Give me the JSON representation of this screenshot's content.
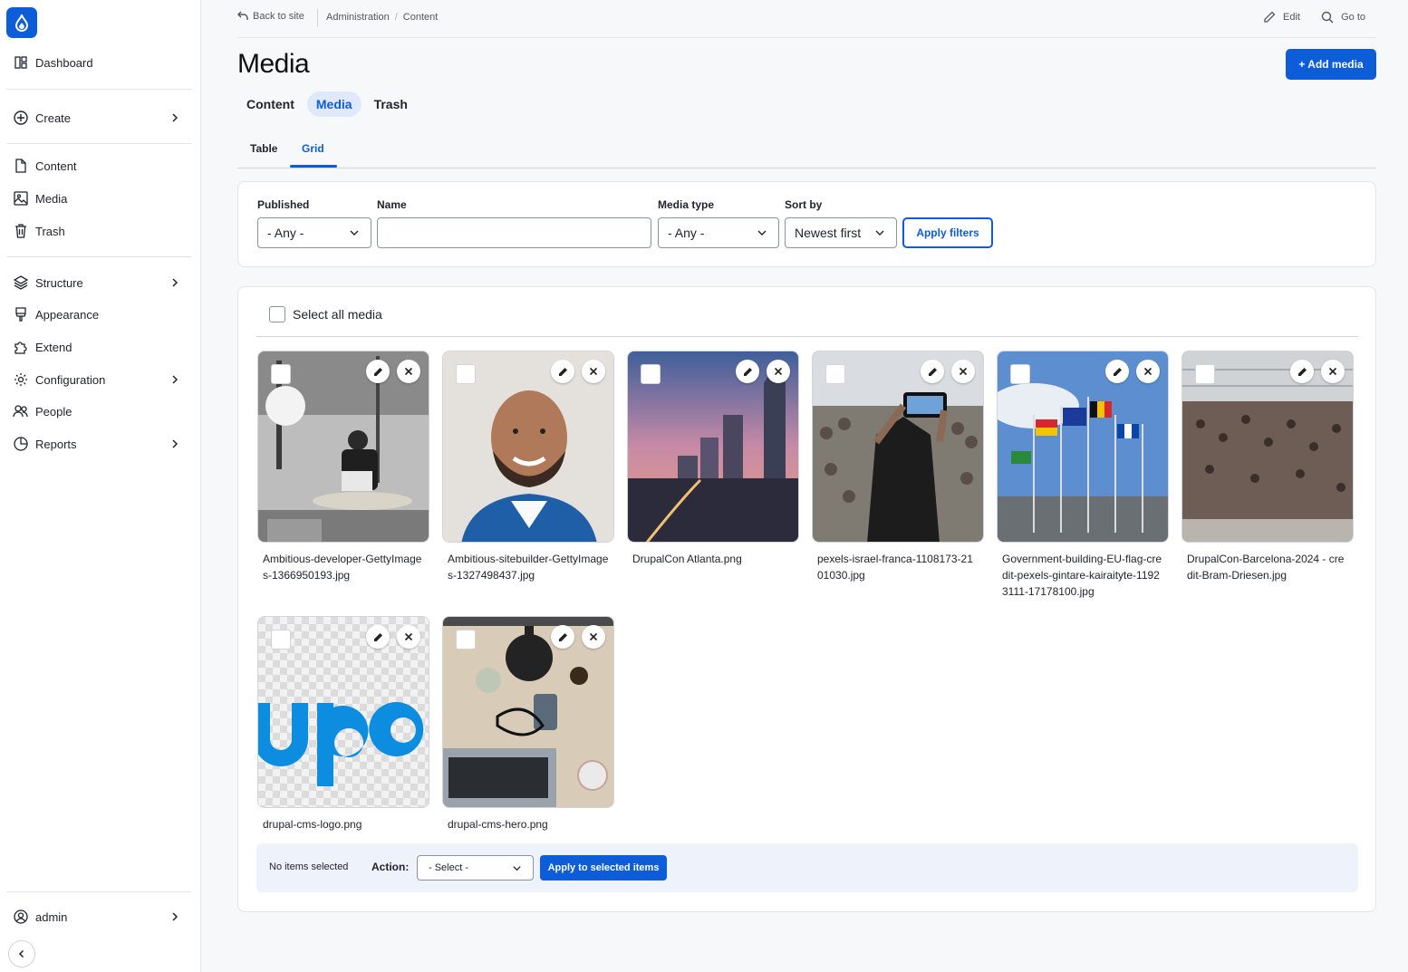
{
  "sidebar": {
    "items": [
      {
        "label": "Dashboard",
        "icon": "dashboard-icon"
      },
      {
        "label": "Create",
        "icon": "plus-circle-icon"
      },
      {
        "label": "Content",
        "icon": "file-icon"
      },
      {
        "label": "Media",
        "icon": "image-icon"
      },
      {
        "label": "Trash",
        "icon": "trash-icon"
      },
      {
        "label": "Structure",
        "icon": "layers-icon"
      },
      {
        "label": "Appearance",
        "icon": "paintbrush-icon"
      },
      {
        "label": "Extend",
        "icon": "puzzle-icon"
      },
      {
        "label": "Configuration",
        "icon": "gear-icon"
      },
      {
        "label": "People",
        "icon": "people-icon"
      },
      {
        "label": "Reports",
        "icon": "pie-chart-icon"
      }
    ],
    "user": "admin"
  },
  "topbar": {
    "back": "Back to site",
    "breadcrumbs": [
      "Administration",
      "Content"
    ],
    "edit": "Edit",
    "goto": "Go to"
  },
  "page": {
    "title": "Media",
    "add_button": "+ Add media"
  },
  "tabs": {
    "primary": [
      "Content",
      "Media",
      "Trash"
    ],
    "secondary": [
      "Table",
      "Grid"
    ]
  },
  "filters": {
    "published_label": "Published",
    "published_value": "- Any -",
    "name_label": "Name",
    "name_value": "",
    "media_type_label": "Media type",
    "media_type_value": "- Any -",
    "sort_label": "Sort by",
    "sort_value": "Newest first",
    "apply_label": "Apply filters"
  },
  "media": {
    "select_all": "Select all media",
    "items": [
      "Ambitious-developer-GettyImages-1366950193.jpg",
      "Ambitious-sitebuilder-GettyImages-1327498437.jpg",
      "DrupalCon Atlanta.png",
      "pexels-israel-franca-1108173-2101030.jpg",
      "Government-building-EU-flag-credit-pexels-gintare-kairaityte-11923111-17178100.jpg",
      "DrupalCon-Barcelona-2024 - credit-Bram-Driesen.jpg",
      "drupal-cms-logo.png",
      "drupal-cms-hero.png"
    ]
  },
  "bulk": {
    "status": "No items selected",
    "action_label": "Action:",
    "action_value": "- Select -",
    "apply_label": "Apply to selected items"
  },
  "colors": {
    "accent": "#0d5cd8",
    "active_tab_bg": "#e0e9fb",
    "bulk_bg": "#eef2fb"
  }
}
